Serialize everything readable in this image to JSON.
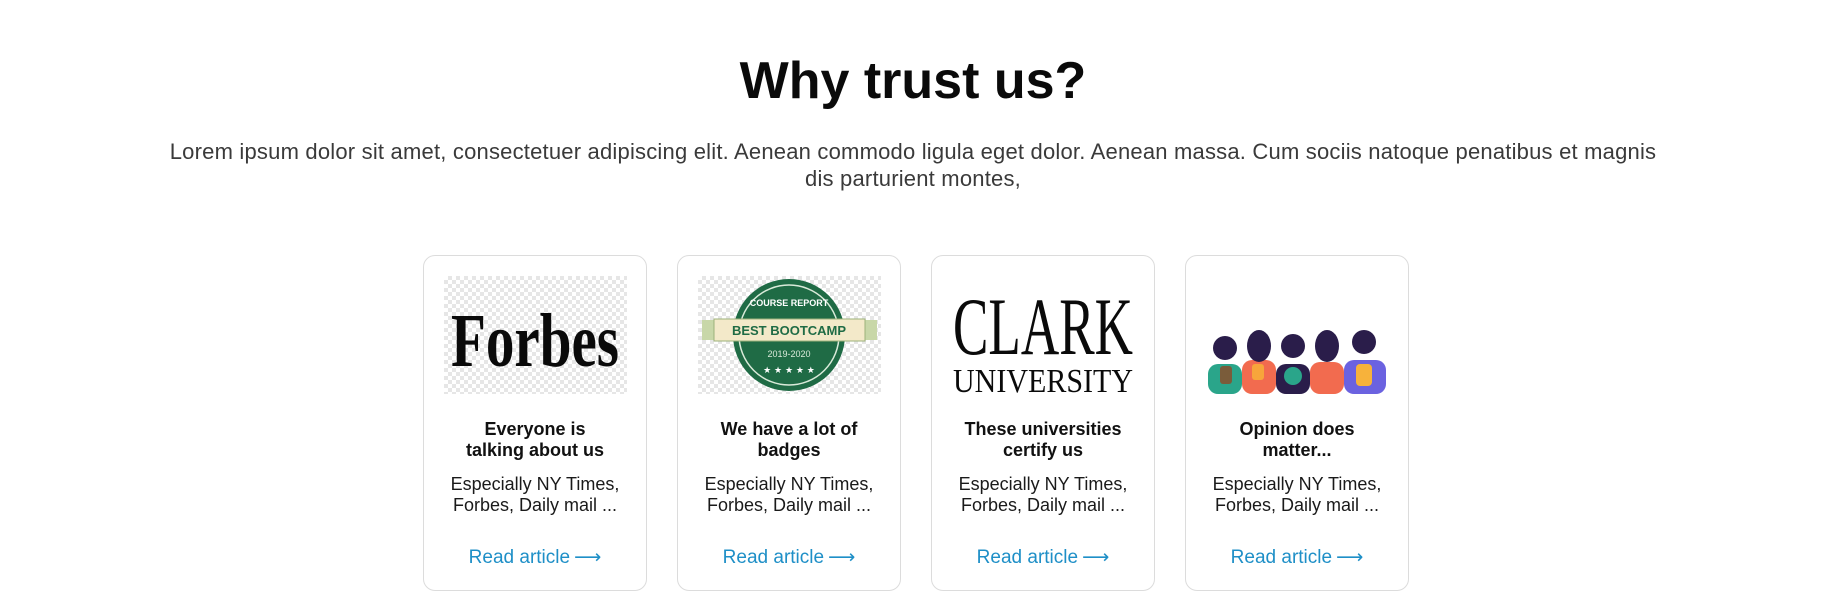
{
  "section": {
    "title": "Why trust us?",
    "lead": "Lorem ipsum dolor sit amet, consectetuer adipiscing elit. Aenean commodo ligula eget dolor. Aenean massa. Cum sociis natoque penatibus et magnis dis parturient montes,"
  },
  "cards": [
    {
      "logo": "forbes-logo",
      "logo_text": "Forbes",
      "title": "Everyone is talking about us",
      "description": "Especially NY Times, Forbes, Daily mail ...",
      "link_label": "Read article",
      "link_arrow": "⟶"
    },
    {
      "logo": "course-report-badge",
      "logo_text_top": "COURSE REPORT",
      "logo_text_ribbon": "BEST BOOTCAMP",
      "logo_text_year": "2019-2020",
      "title": "We have a lot of badges",
      "description": "Especially NY Times, Forbes, Daily mail ...",
      "link_label": "Read article",
      "link_arrow": "⟶"
    },
    {
      "logo": "clark-university-logo",
      "logo_text_top": "CLARK",
      "logo_text_bottom": "UNIVERSITY",
      "title": "These universities certify us",
      "description": "Especially NY Times, Forbes, Daily mail ...",
      "link_label": "Read article",
      "link_arrow": "⟶"
    },
    {
      "logo": "students-illustration",
      "title": "Opinion does matter...",
      "description": "Especially NY Times, Forbes, Daily mail ...",
      "link_label": "Read article",
      "link_arrow": "⟶"
    }
  ],
  "colors": {
    "link": "#1e8fc7",
    "badge_green": "#1f6b45",
    "ribbon": "#f3e9c9"
  }
}
